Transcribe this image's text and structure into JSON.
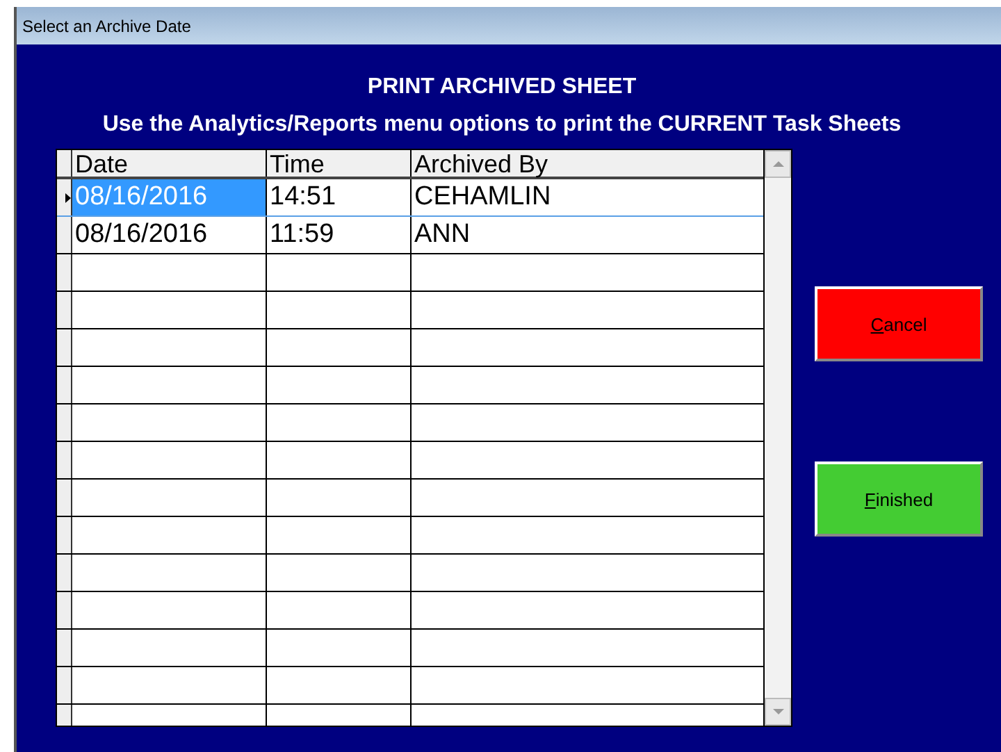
{
  "window": {
    "title": "Select an Archive Date"
  },
  "heading": "PRINT ARCHIVED SHEET",
  "instructions": "Use the Analytics/Reports menu options to print the CURRENT Task Sheets",
  "table": {
    "columns": [
      "Date",
      "Time",
      "Archived By"
    ],
    "rows": [
      {
        "cells": [
          "08/16/2016",
          "14:51",
          "CEHAMLIN"
        ],
        "selected": true
      },
      {
        "cells": [
          "08/16/2016",
          "11:59",
          "ANN"
        ],
        "selected": false
      }
    ]
  },
  "buttons": [
    {
      "label": "Cancel",
      "kind": "cancel"
    },
    {
      "label": "Finished",
      "kind": "finish"
    }
  ]
}
